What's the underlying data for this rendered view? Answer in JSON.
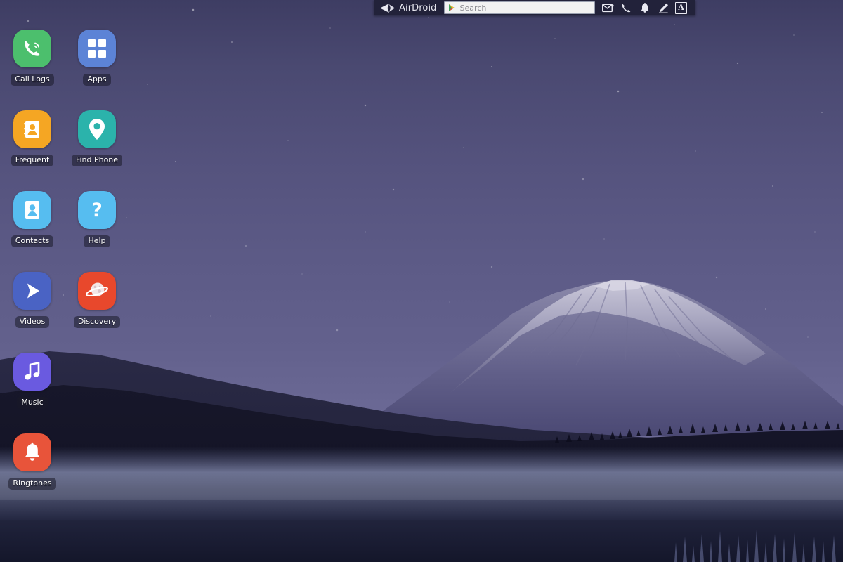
{
  "toolbar": {
    "brand": "AirDroid",
    "back_icon": "back-arrow-icon",
    "search": {
      "placeholder": "Search",
      "value": "",
      "leading_icon": "play-store-icon"
    },
    "actions": [
      {
        "name": "messages-icon",
        "label": "Messages",
        "glyph": "mail"
      },
      {
        "name": "phone-icon",
        "label": "Phone",
        "glyph": "phone"
      },
      {
        "name": "notifications-icon",
        "label": "Notifications",
        "glyph": "bell"
      },
      {
        "name": "edit-icon",
        "label": "Edit",
        "glyph": "pencil"
      },
      {
        "name": "letter-a-button",
        "label": "A",
        "glyph": "letter"
      }
    ],
    "background_color": "#22223a"
  },
  "desktop": {
    "wallpaper": {
      "description": "Mount Fuji at twilight under a starry purple sky with misty lake",
      "sky_top_color": "#3e3d63",
      "sky_bottom_color": "#6f6d98",
      "mountain_snow_color": "#b9b7cd",
      "ridge_color": "#1b1b2e",
      "mist_color": "#8d94b5"
    },
    "icons": [
      {
        "label": "Call Logs",
        "icon": "phone-call-icon",
        "bg": "#4cbf6d",
        "fg": "#ffffff"
      },
      {
        "label": "Apps",
        "icon": "app-grid-icon",
        "bg": "#5c83d6",
        "fg": "#ffffff"
      },
      {
        "label": "Frequent",
        "icon": "contact-card-icon",
        "bg": "#f5a623",
        "fg": "#ffffff"
      },
      {
        "label": "Find Phone",
        "icon": "map-pin-icon",
        "bg": "#2bb3ab",
        "fg": "#ffffff"
      },
      {
        "label": "Contacts",
        "icon": "contact-card-icon",
        "bg": "#56bdf0",
        "fg": "#ffffff"
      },
      {
        "label": "Help",
        "icon": "question-mark-icon",
        "bg": "#56bdf0",
        "fg": "#ffffff"
      },
      {
        "label": "Videos",
        "icon": "play-triangle-icon",
        "bg": "#4a63c4",
        "fg": "#ffffff"
      },
      {
        "label": "Discovery",
        "icon": "planet-icon",
        "bg": "#e8482c",
        "fg": "#ffffff"
      },
      {
        "label": "Music",
        "icon": "music-note-icon",
        "bg": "#6a5ae0",
        "fg": "#ffffff"
      },
      {
        "label": "Ringtones",
        "icon": "bell-icon",
        "bg": "#e8543a",
        "fg": "#ffffff"
      }
    ]
  }
}
